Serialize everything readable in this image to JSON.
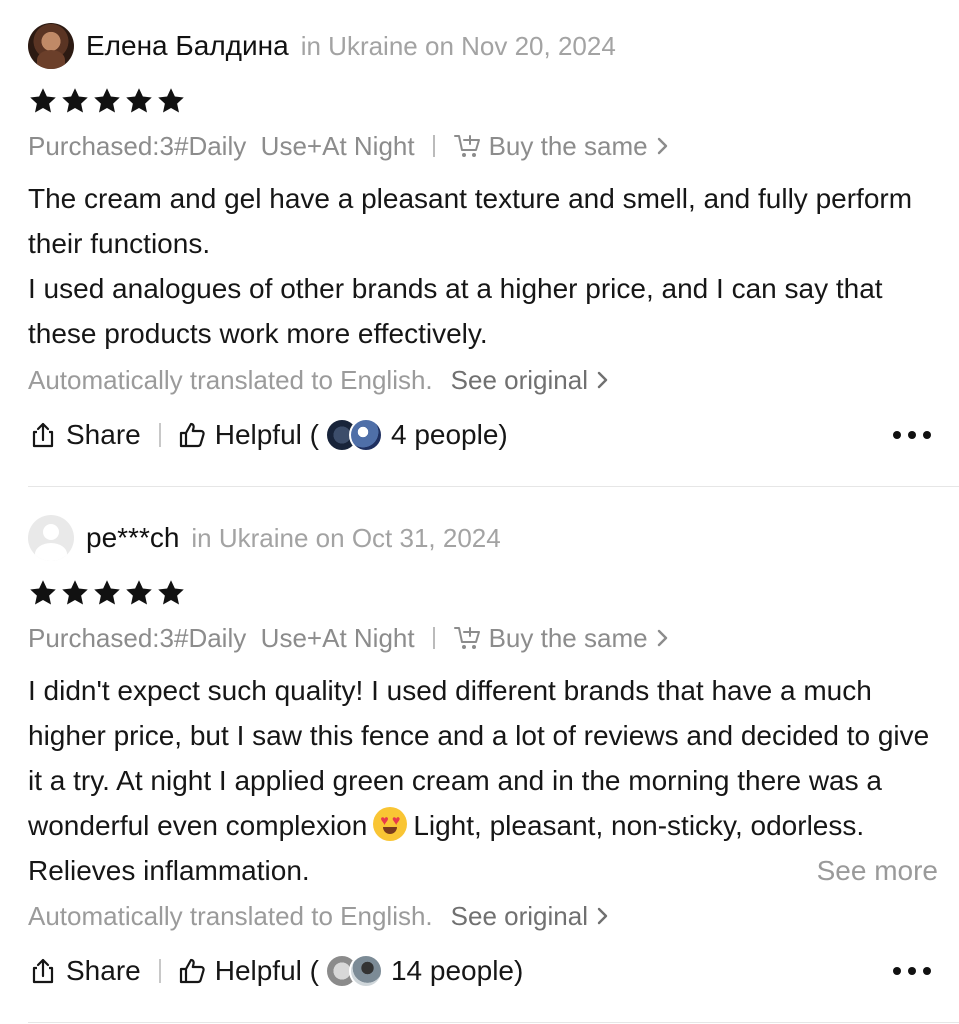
{
  "reviews": [
    {
      "name": "Елена Балдина",
      "meta": "in Ukraine on Nov 20, 2024",
      "avatar_icon": "user-photo",
      "rating": 5,
      "purchased": "Purchased:3#Daily  Use+At Night",
      "buy_same": "Buy the same",
      "body_lines": [
        "The cream and gel have a pleasant texture and smell, and fully perform their functions.",
        "I used analogues of other brands at a higher price, and I can say that these products work more effectively."
      ],
      "translated": "Automatically translated to English.",
      "see_original": "See original",
      "share": "Share",
      "helpful_prefix": "Helpful (",
      "helpful_count": "4 people",
      "helpful_suffix": ")"
    },
    {
      "name": "pe***ch",
      "meta": "in Ukraine on Oct 31, 2024",
      "avatar_icon": "default-avatar",
      "rating": 5,
      "purchased": "Purchased:3#Daily  Use+At Night",
      "buy_same": "Buy the same",
      "body_part1": "I didn't expect such quality! I used different brands that have a much higher price, but I saw this fence and a lot of reviews and decided to give it a try. At night I applied green cream and in the morning there was a wonderful even complexion",
      "body_part2": "Light, pleasant, non-sticky, odorless. Relieves inflammation.",
      "emoji": "smiling-face-with-heart-eyes",
      "see_more": "See more",
      "translated": "Automatically translated to English.",
      "see_original": "See original",
      "share": "Share",
      "helpful_prefix": "Helpful (",
      "helpful_count": "14 people",
      "helpful_suffix": ")"
    }
  ],
  "colors": {
    "star": "#111111",
    "meta": "#a3a3a3",
    "divider": "#e6e6e6"
  }
}
